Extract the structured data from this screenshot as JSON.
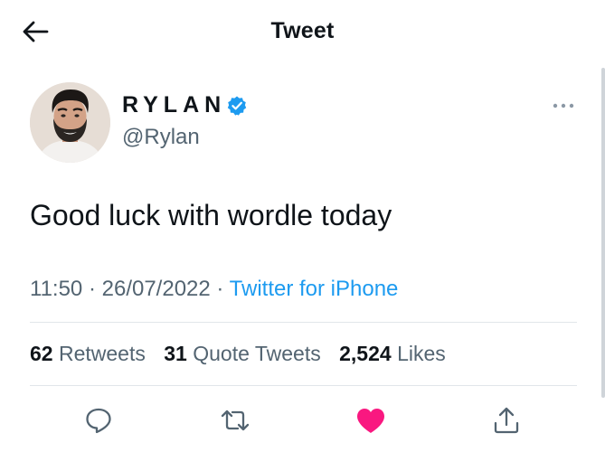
{
  "header": {
    "title": "Tweet",
    "back_icon": "arrow-left-icon"
  },
  "author": {
    "display_name": "RYLAN",
    "handle": "@Rylan",
    "verified": true,
    "verified_color": "#1d9bf0"
  },
  "tweet": {
    "text": "Good luck with wordle today",
    "time": "11:50",
    "date": "26/07/2022",
    "source": "Twitter for iPhone",
    "separator": "·"
  },
  "stats": {
    "retweets_count": "62",
    "retweets_label": "Retweets",
    "quotes_count": "31",
    "quotes_label": "Quote Tweets",
    "likes_count": "2,524",
    "likes_label": "Likes"
  },
  "actions": {
    "reply_icon": "reply-bubble-icon",
    "retweet_icon": "retweet-icon",
    "like_icon": "heart-filled-icon",
    "share_icon": "share-icon",
    "like_color": "#f91880"
  },
  "colors": {
    "text": "#0f1419",
    "muted": "#536471",
    "link": "#1d9bf0"
  }
}
